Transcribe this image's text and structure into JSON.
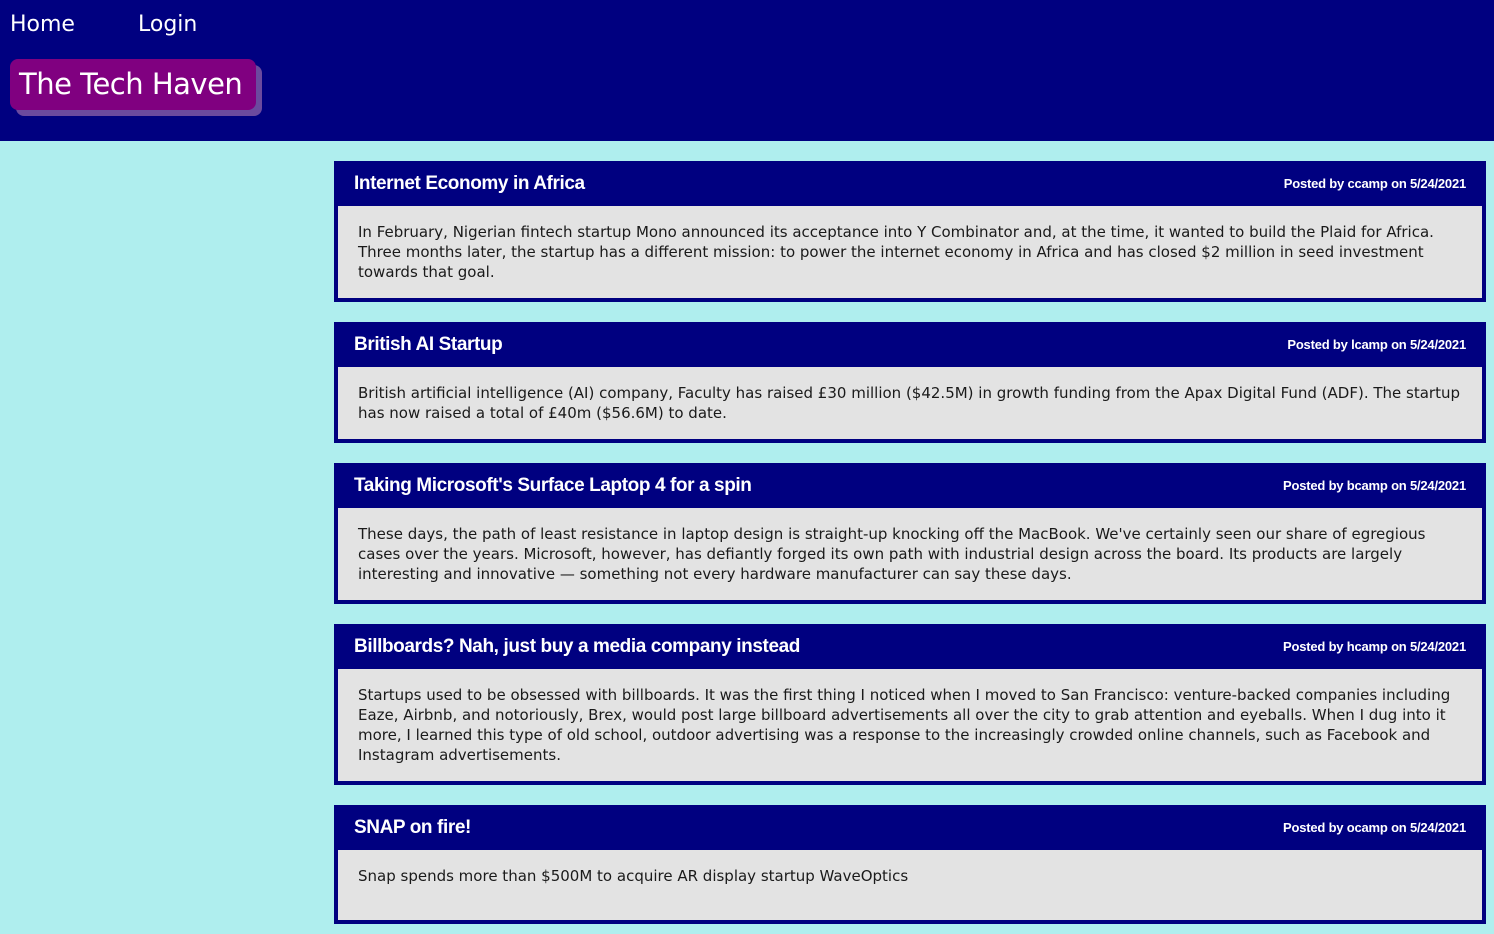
{
  "nav": {
    "home": "Home",
    "login": "Login"
  },
  "brand": "The Tech Haven",
  "colors": {
    "header_bg": "#000080",
    "page_bg": "#afeeee",
    "brand_bg": "#800080",
    "post_body_bg": "#e3e3e3"
  },
  "posts": [
    {
      "title": "Internet Economy in Africa",
      "meta": "Posted by ccamp on 5/24/2021",
      "body": "In February, Nigerian fintech startup Mono announced its acceptance into Y Combinator and, at the time, it wanted to build the Plaid for Africa. Three months later, the startup has a different mission: to power the internet economy in Africa and has closed $2 million in seed investment towards that goal."
    },
    {
      "title": "British AI Startup",
      "meta": "Posted by lcamp on 5/24/2021",
      "body": "British artificial intelligence (AI) company, Faculty has raised £30 million ($42.5M) in growth funding from the Apax Digital Fund (ADF). The startup has now raised a total of £40m ($56.6M) to date."
    },
    {
      "title": "Taking Microsoft's Surface Laptop 4 for a spin",
      "meta": "Posted by bcamp on 5/24/2021",
      "body": "These days, the path of least resistance in laptop design is straight-up knocking off the MacBook. We've certainly seen our share of egregious cases over the years. Microsoft, however, has defiantly forged its own path with industrial design across the board. Its products are largely interesting and innovative — something not every hardware manufacturer can say these days."
    },
    {
      "title": "Billboards? Nah, just buy a media company instead",
      "meta": "Posted by hcamp on 5/24/2021",
      "body": "Startups used to be obsessed with billboards. It was the first thing I noticed when I moved to San Francisco: venture-backed companies including Eaze, Airbnb, and notoriously, Brex, would post large billboard advertisements all over the city to grab attention and eyeballs. When I dug into it more, I learned this type of old school, outdoor advertising was a response to the increasingly crowded online channels, such as Facebook and Instagram advertisements."
    },
    {
      "title": "SNAP on fire!",
      "meta": "Posted by ocamp on 5/24/2021",
      "body": "Snap spends more than $500M to acquire AR display startup WaveOptics"
    }
  ]
}
